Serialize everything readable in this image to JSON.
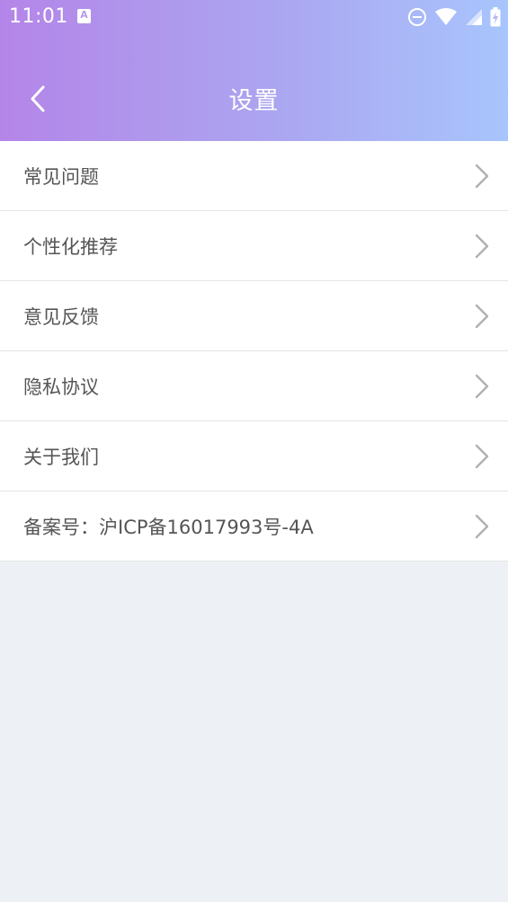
{
  "status_bar": {
    "time": "11:01",
    "notification_letter": "A"
  },
  "header": {
    "title": "设置"
  },
  "menu": {
    "items": [
      {
        "label": "常见问题"
      },
      {
        "label": "个性化推荐"
      },
      {
        "label": "意见反馈"
      },
      {
        "label": "隐私协议"
      },
      {
        "label": "关于我们"
      },
      {
        "label": "备案号：沪ICP备16017993号-4A"
      }
    ]
  },
  "colors": {
    "header_gradient_start": "#b485e8",
    "header_gradient_end": "#a8c5fd",
    "page_background": "#edf1f6",
    "row_text": "#555555",
    "chevron": "#b0b0b0"
  }
}
